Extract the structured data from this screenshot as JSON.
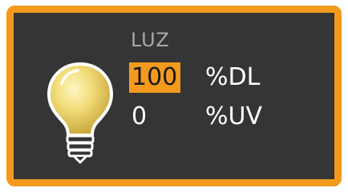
{
  "panel": {
    "title": "LUZ",
    "icon": "light-bulb-icon",
    "accent_color": "#f39a1e",
    "background_color": "#353535",
    "rows": [
      {
        "value": "100",
        "unit": "%DL",
        "highlighted": true
      },
      {
        "value": "0",
        "unit": "%UV",
        "highlighted": false
      }
    ]
  }
}
